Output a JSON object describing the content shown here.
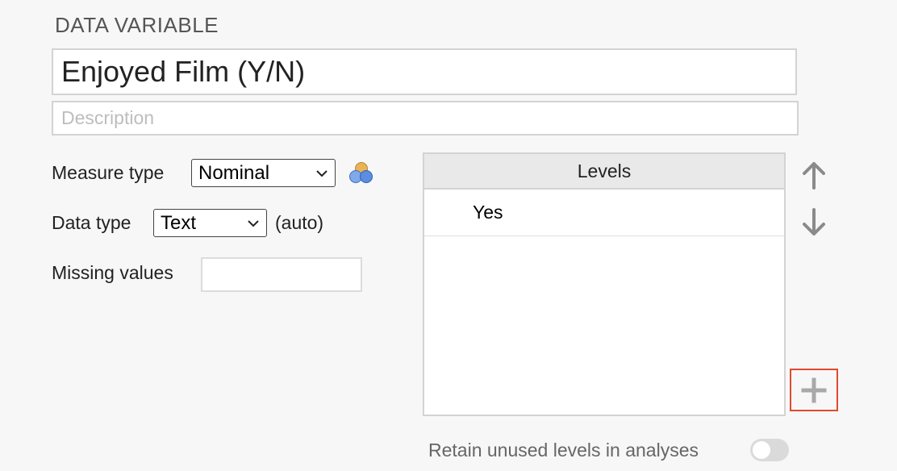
{
  "section": {
    "title": "DATA VARIABLE"
  },
  "variable": {
    "name": "Enjoyed Film (Y/N)",
    "description_placeholder": "Description"
  },
  "measure_type": {
    "label": "Measure type",
    "selected": "Nominal",
    "icon": "nominal-measure-icon"
  },
  "data_type": {
    "label": "Data type",
    "selected": "Text",
    "note": "(auto)"
  },
  "missing_values": {
    "label": "Missing values",
    "value": ""
  },
  "levels": {
    "header": "Levels",
    "items": [
      {
        "label": "Yes"
      }
    ]
  },
  "controls": {
    "move_up_icon": "arrow-up-icon",
    "move_down_icon": "arrow-down-icon",
    "add_icon": "plus-icon"
  },
  "retain_unused": {
    "label": "Retain unused levels in analyses",
    "enabled": false
  },
  "colors": {
    "highlight": "#e0492f",
    "panel_header": "#e9e9e9"
  }
}
